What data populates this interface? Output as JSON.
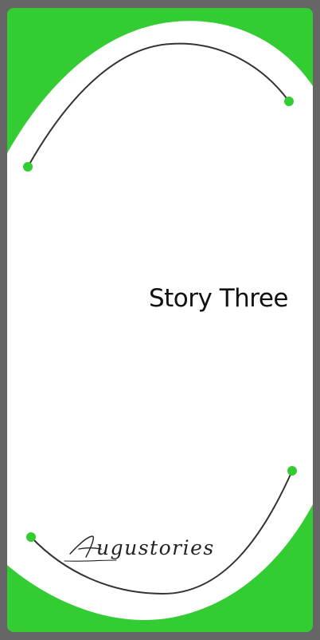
{
  "story": {
    "title": "Story Three",
    "brand": "Augustories"
  },
  "colors": {
    "frame": "#666666",
    "accent": "#34cc33",
    "panel": "#ffffff",
    "line": "#333333"
  },
  "icons": [
    "dot-icon",
    "curve-line"
  ]
}
